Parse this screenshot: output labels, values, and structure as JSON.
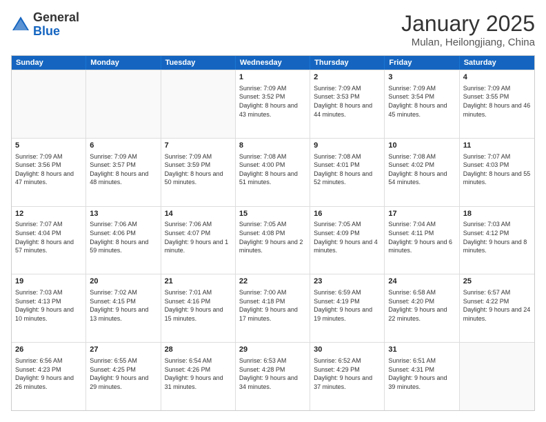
{
  "header": {
    "logo_line1": "General",
    "logo_line2": "Blue",
    "month": "January 2025",
    "location": "Mulan, Heilongjiang, China"
  },
  "weekdays": [
    "Sunday",
    "Monday",
    "Tuesday",
    "Wednesday",
    "Thursday",
    "Friday",
    "Saturday"
  ],
  "weeks": [
    [
      {
        "day": "",
        "text": ""
      },
      {
        "day": "",
        "text": ""
      },
      {
        "day": "",
        "text": ""
      },
      {
        "day": "1",
        "text": "Sunrise: 7:09 AM\nSunset: 3:52 PM\nDaylight: 8 hours\nand 43 minutes."
      },
      {
        "day": "2",
        "text": "Sunrise: 7:09 AM\nSunset: 3:53 PM\nDaylight: 8 hours\nand 44 minutes."
      },
      {
        "day": "3",
        "text": "Sunrise: 7:09 AM\nSunset: 3:54 PM\nDaylight: 8 hours\nand 45 minutes."
      },
      {
        "day": "4",
        "text": "Sunrise: 7:09 AM\nSunset: 3:55 PM\nDaylight: 8 hours\nand 46 minutes."
      }
    ],
    [
      {
        "day": "5",
        "text": "Sunrise: 7:09 AM\nSunset: 3:56 PM\nDaylight: 8 hours\nand 47 minutes."
      },
      {
        "day": "6",
        "text": "Sunrise: 7:09 AM\nSunset: 3:57 PM\nDaylight: 8 hours\nand 48 minutes."
      },
      {
        "day": "7",
        "text": "Sunrise: 7:09 AM\nSunset: 3:59 PM\nDaylight: 8 hours\nand 50 minutes."
      },
      {
        "day": "8",
        "text": "Sunrise: 7:08 AM\nSunset: 4:00 PM\nDaylight: 8 hours\nand 51 minutes."
      },
      {
        "day": "9",
        "text": "Sunrise: 7:08 AM\nSunset: 4:01 PM\nDaylight: 8 hours\nand 52 minutes."
      },
      {
        "day": "10",
        "text": "Sunrise: 7:08 AM\nSunset: 4:02 PM\nDaylight: 8 hours\nand 54 minutes."
      },
      {
        "day": "11",
        "text": "Sunrise: 7:07 AM\nSunset: 4:03 PM\nDaylight: 8 hours\nand 55 minutes."
      }
    ],
    [
      {
        "day": "12",
        "text": "Sunrise: 7:07 AM\nSunset: 4:04 PM\nDaylight: 8 hours\nand 57 minutes."
      },
      {
        "day": "13",
        "text": "Sunrise: 7:06 AM\nSunset: 4:06 PM\nDaylight: 8 hours\nand 59 minutes."
      },
      {
        "day": "14",
        "text": "Sunrise: 7:06 AM\nSunset: 4:07 PM\nDaylight: 9 hours\nand 1 minute."
      },
      {
        "day": "15",
        "text": "Sunrise: 7:05 AM\nSunset: 4:08 PM\nDaylight: 9 hours\nand 2 minutes."
      },
      {
        "day": "16",
        "text": "Sunrise: 7:05 AM\nSunset: 4:09 PM\nDaylight: 9 hours\nand 4 minutes."
      },
      {
        "day": "17",
        "text": "Sunrise: 7:04 AM\nSunset: 4:11 PM\nDaylight: 9 hours\nand 6 minutes."
      },
      {
        "day": "18",
        "text": "Sunrise: 7:03 AM\nSunset: 4:12 PM\nDaylight: 9 hours\nand 8 minutes."
      }
    ],
    [
      {
        "day": "19",
        "text": "Sunrise: 7:03 AM\nSunset: 4:13 PM\nDaylight: 9 hours\nand 10 minutes."
      },
      {
        "day": "20",
        "text": "Sunrise: 7:02 AM\nSunset: 4:15 PM\nDaylight: 9 hours\nand 13 minutes."
      },
      {
        "day": "21",
        "text": "Sunrise: 7:01 AM\nSunset: 4:16 PM\nDaylight: 9 hours\nand 15 minutes."
      },
      {
        "day": "22",
        "text": "Sunrise: 7:00 AM\nSunset: 4:18 PM\nDaylight: 9 hours\nand 17 minutes."
      },
      {
        "day": "23",
        "text": "Sunrise: 6:59 AM\nSunset: 4:19 PM\nDaylight: 9 hours\nand 19 minutes."
      },
      {
        "day": "24",
        "text": "Sunrise: 6:58 AM\nSunset: 4:20 PM\nDaylight: 9 hours\nand 22 minutes."
      },
      {
        "day": "25",
        "text": "Sunrise: 6:57 AM\nSunset: 4:22 PM\nDaylight: 9 hours\nand 24 minutes."
      }
    ],
    [
      {
        "day": "26",
        "text": "Sunrise: 6:56 AM\nSunset: 4:23 PM\nDaylight: 9 hours\nand 26 minutes."
      },
      {
        "day": "27",
        "text": "Sunrise: 6:55 AM\nSunset: 4:25 PM\nDaylight: 9 hours\nand 29 minutes."
      },
      {
        "day": "28",
        "text": "Sunrise: 6:54 AM\nSunset: 4:26 PM\nDaylight: 9 hours\nand 31 minutes."
      },
      {
        "day": "29",
        "text": "Sunrise: 6:53 AM\nSunset: 4:28 PM\nDaylight: 9 hours\nand 34 minutes."
      },
      {
        "day": "30",
        "text": "Sunrise: 6:52 AM\nSunset: 4:29 PM\nDaylight: 9 hours\nand 37 minutes."
      },
      {
        "day": "31",
        "text": "Sunrise: 6:51 AM\nSunset: 4:31 PM\nDaylight: 9 hours\nand 39 minutes."
      },
      {
        "day": "",
        "text": ""
      }
    ]
  ]
}
